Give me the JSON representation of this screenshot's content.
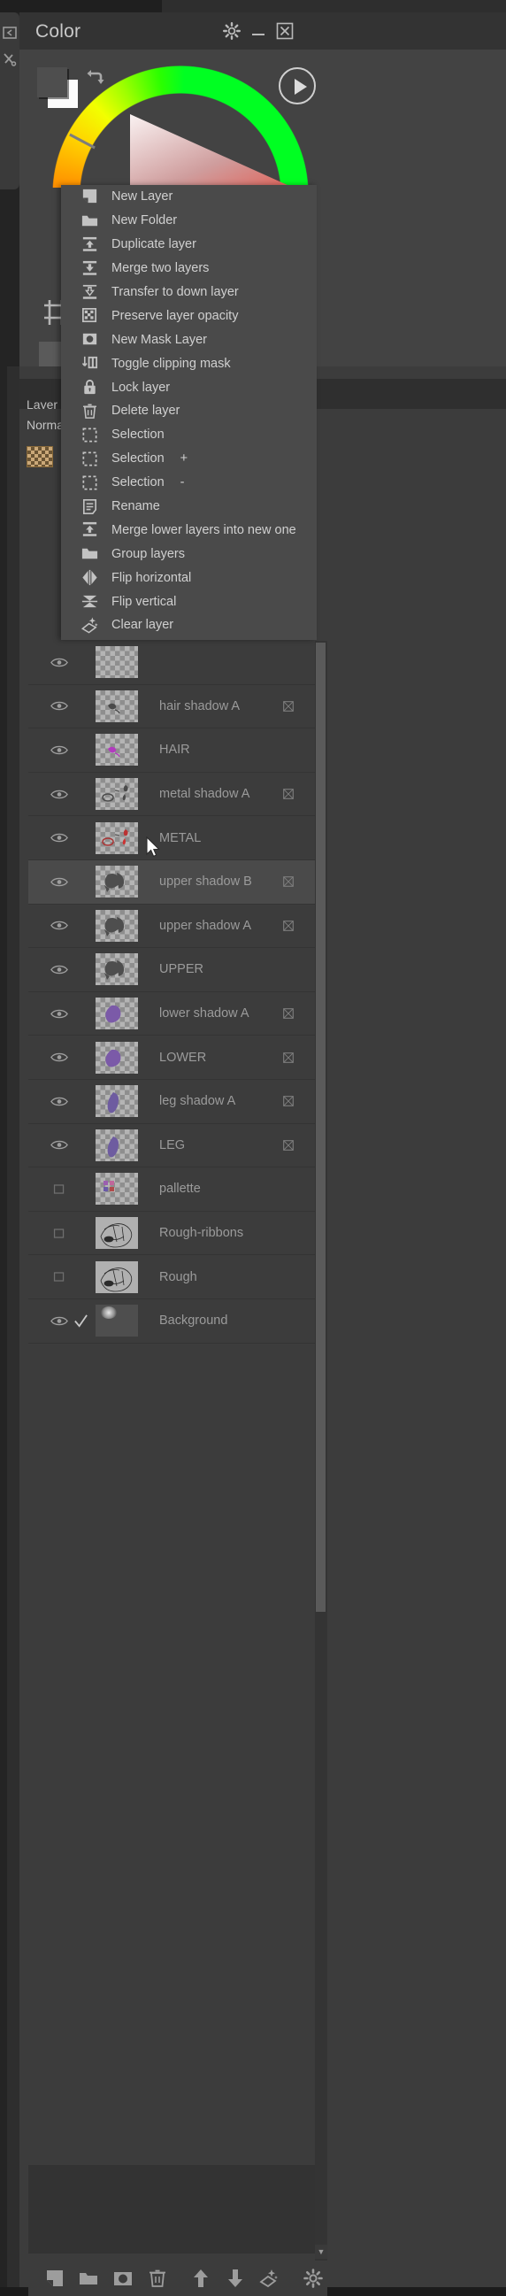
{
  "app": {
    "color_panel": {
      "title": "Color",
      "icons": [
        "gear-icon",
        "minimize-icon",
        "close-icon"
      ],
      "play_icon": "play-icon",
      "swap_icon": "swap-colors-icon",
      "foreground_color": "#4e4e4e",
      "background_color": "#fbfbfb"
    },
    "layer_panel": {
      "tab_label": "Layer",
      "blend_mode": "Normal"
    },
    "context_menu": {
      "items": [
        {
          "label": "New Layer",
          "icon": "new-layer-icon",
          "suffix": ""
        },
        {
          "label": "New Folder",
          "icon": "folder-icon",
          "suffix": ""
        },
        {
          "label": "Duplicate layer",
          "icon": "duplicate-layer-icon",
          "suffix": ""
        },
        {
          "label": "Merge two layers",
          "icon": "merge-down-icon",
          "suffix": ""
        },
        {
          "label": "Transfer to down layer",
          "icon": "transfer-down-icon",
          "suffix": ""
        },
        {
          "label": "Preserve layer opacity",
          "icon": "checker-icon",
          "suffix": ""
        },
        {
          "label": "New Mask Layer",
          "icon": "mask-layer-icon",
          "suffix": ""
        },
        {
          "label": "Toggle clipping mask",
          "icon": "clipping-mask-icon",
          "suffix": ""
        },
        {
          "label": "Lock layer",
          "icon": "lock-icon",
          "suffix": ""
        },
        {
          "label": "Delete layer",
          "icon": "trash-icon",
          "suffix": ""
        },
        {
          "label": "Selection",
          "icon": "selection-icon",
          "suffix": ""
        },
        {
          "label": "Selection",
          "icon": "selection-icon",
          "suffix": "+"
        },
        {
          "label": "Selection",
          "icon": "selection-icon",
          "suffix": "-"
        },
        {
          "label": "Rename",
          "icon": "rename-icon",
          "suffix": ""
        },
        {
          "label": "Merge lower layers into new one",
          "icon": "merge-lower-icon",
          "suffix": ""
        },
        {
          "label": "Group layers",
          "icon": "folder-icon",
          "suffix": ""
        },
        {
          "label": "Flip horizontal",
          "icon": "flip-horizontal-icon",
          "suffix": ""
        },
        {
          "label": "Flip vertical",
          "icon": "flip-vertical-icon",
          "suffix": ""
        },
        {
          "label": "Clear layer",
          "icon": "clear-layer-icon",
          "suffix": ""
        }
      ]
    },
    "layers": [
      {
        "name": "",
        "visible": true,
        "clipped": false,
        "selected": false,
        "thumb": "transparent",
        "checked": false
      },
      {
        "name": "hair shadow A",
        "visible": true,
        "clipped": true,
        "selected": false,
        "thumb": "transparent",
        "checked": false
      },
      {
        "name": "HAIR",
        "visible": true,
        "clipped": false,
        "selected": false,
        "thumb": "transparent",
        "checked": false
      },
      {
        "name": "metal shadow A",
        "visible": true,
        "clipped": true,
        "selected": false,
        "thumb": "transparent",
        "checked": false
      },
      {
        "name": "METAL",
        "visible": true,
        "clipped": false,
        "selected": false,
        "thumb": "transparent",
        "checked": false
      },
      {
        "name": "upper shadow B",
        "visible": true,
        "clipped": true,
        "selected": true,
        "thumb": "transparent",
        "checked": false
      },
      {
        "name": "upper shadow A",
        "visible": true,
        "clipped": true,
        "selected": false,
        "thumb": "transparent",
        "checked": false
      },
      {
        "name": "UPPER",
        "visible": true,
        "clipped": false,
        "selected": false,
        "thumb": "transparent",
        "checked": false
      },
      {
        "name": "lower shadow A",
        "visible": true,
        "clipped": true,
        "selected": false,
        "thumb": "transparent",
        "checked": false
      },
      {
        "name": "LOWER",
        "visible": true,
        "clipped": true,
        "selected": false,
        "thumb": "transparent",
        "checked": false
      },
      {
        "name": "leg shadow A",
        "visible": true,
        "clipped": true,
        "selected": false,
        "thumb": "transparent",
        "checked": false
      },
      {
        "name": "LEG",
        "visible": true,
        "clipped": true,
        "selected": false,
        "thumb": "transparent",
        "checked": false
      },
      {
        "name": "pallette",
        "visible": false,
        "clipped": false,
        "selected": false,
        "thumb": "transparent",
        "checked": false
      },
      {
        "name": "Rough-ribbons",
        "visible": false,
        "clipped": false,
        "selected": false,
        "thumb": "opaque",
        "checked": false
      },
      {
        "name": "Rough",
        "visible": false,
        "clipped": false,
        "selected": false,
        "thumb": "opaque",
        "checked": false
      },
      {
        "name": "Background",
        "visible": true,
        "clipped": false,
        "selected": false,
        "thumb": "dark",
        "checked": true
      }
    ],
    "bottom_toolbar": [
      {
        "icon": "new-layer-icon",
        "label": "New Layer"
      },
      {
        "icon": "folder-icon",
        "label": "New Folder"
      },
      {
        "icon": "mask-layer-icon",
        "label": "New Mask Layer"
      },
      {
        "icon": "trash-icon",
        "label": "Delete layer"
      },
      {
        "icon": "move-up-icon",
        "label": "Move layer up"
      },
      {
        "icon": "move-down-icon",
        "label": "Move layer down"
      },
      {
        "icon": "clear-layer-icon",
        "label": "Clear layer"
      },
      {
        "icon": "gear-icon",
        "label": "Settings"
      }
    ],
    "colors": {
      "panel_bg": "#3c3c3c",
      "menu_bg": "#4a4a4a",
      "titlebar_bg": "#333333",
      "text": "#d0d0d0",
      "layer_text": "#9b9b9b",
      "selected_row": "#4a4a4a"
    }
  }
}
